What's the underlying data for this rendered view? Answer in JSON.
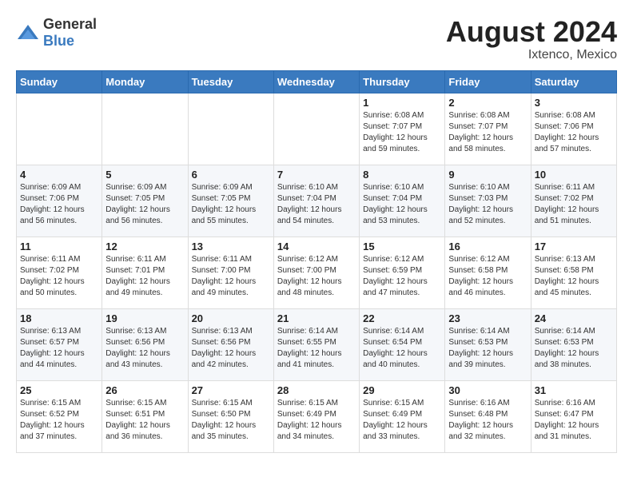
{
  "header": {
    "logo_general": "General",
    "logo_blue": "Blue",
    "month_year": "August 2024",
    "location": "Ixtenco, Mexico"
  },
  "weekdays": [
    "Sunday",
    "Monday",
    "Tuesday",
    "Wednesday",
    "Thursday",
    "Friday",
    "Saturday"
  ],
  "weeks": [
    [
      {
        "day": "",
        "content": ""
      },
      {
        "day": "",
        "content": ""
      },
      {
        "day": "",
        "content": ""
      },
      {
        "day": "",
        "content": ""
      },
      {
        "day": "1",
        "content": "Sunrise: 6:08 AM\nSunset: 7:07 PM\nDaylight: 12 hours\nand 59 minutes."
      },
      {
        "day": "2",
        "content": "Sunrise: 6:08 AM\nSunset: 7:07 PM\nDaylight: 12 hours\nand 58 minutes."
      },
      {
        "day": "3",
        "content": "Sunrise: 6:08 AM\nSunset: 7:06 PM\nDaylight: 12 hours\nand 57 minutes."
      }
    ],
    [
      {
        "day": "4",
        "content": "Sunrise: 6:09 AM\nSunset: 7:06 PM\nDaylight: 12 hours\nand 56 minutes."
      },
      {
        "day": "5",
        "content": "Sunrise: 6:09 AM\nSunset: 7:05 PM\nDaylight: 12 hours\nand 56 minutes."
      },
      {
        "day": "6",
        "content": "Sunrise: 6:09 AM\nSunset: 7:05 PM\nDaylight: 12 hours\nand 55 minutes."
      },
      {
        "day": "7",
        "content": "Sunrise: 6:10 AM\nSunset: 7:04 PM\nDaylight: 12 hours\nand 54 minutes."
      },
      {
        "day": "8",
        "content": "Sunrise: 6:10 AM\nSunset: 7:04 PM\nDaylight: 12 hours\nand 53 minutes."
      },
      {
        "day": "9",
        "content": "Sunrise: 6:10 AM\nSunset: 7:03 PM\nDaylight: 12 hours\nand 52 minutes."
      },
      {
        "day": "10",
        "content": "Sunrise: 6:11 AM\nSunset: 7:02 PM\nDaylight: 12 hours\nand 51 minutes."
      }
    ],
    [
      {
        "day": "11",
        "content": "Sunrise: 6:11 AM\nSunset: 7:02 PM\nDaylight: 12 hours\nand 50 minutes."
      },
      {
        "day": "12",
        "content": "Sunrise: 6:11 AM\nSunset: 7:01 PM\nDaylight: 12 hours\nand 49 minutes."
      },
      {
        "day": "13",
        "content": "Sunrise: 6:11 AM\nSunset: 7:00 PM\nDaylight: 12 hours\nand 49 minutes."
      },
      {
        "day": "14",
        "content": "Sunrise: 6:12 AM\nSunset: 7:00 PM\nDaylight: 12 hours\nand 48 minutes."
      },
      {
        "day": "15",
        "content": "Sunrise: 6:12 AM\nSunset: 6:59 PM\nDaylight: 12 hours\nand 47 minutes."
      },
      {
        "day": "16",
        "content": "Sunrise: 6:12 AM\nSunset: 6:58 PM\nDaylight: 12 hours\nand 46 minutes."
      },
      {
        "day": "17",
        "content": "Sunrise: 6:13 AM\nSunset: 6:58 PM\nDaylight: 12 hours\nand 45 minutes."
      }
    ],
    [
      {
        "day": "18",
        "content": "Sunrise: 6:13 AM\nSunset: 6:57 PM\nDaylight: 12 hours\nand 44 minutes."
      },
      {
        "day": "19",
        "content": "Sunrise: 6:13 AM\nSunset: 6:56 PM\nDaylight: 12 hours\nand 43 minutes."
      },
      {
        "day": "20",
        "content": "Sunrise: 6:13 AM\nSunset: 6:56 PM\nDaylight: 12 hours\nand 42 minutes."
      },
      {
        "day": "21",
        "content": "Sunrise: 6:14 AM\nSunset: 6:55 PM\nDaylight: 12 hours\nand 41 minutes."
      },
      {
        "day": "22",
        "content": "Sunrise: 6:14 AM\nSunset: 6:54 PM\nDaylight: 12 hours\nand 40 minutes."
      },
      {
        "day": "23",
        "content": "Sunrise: 6:14 AM\nSunset: 6:53 PM\nDaylight: 12 hours\nand 39 minutes."
      },
      {
        "day": "24",
        "content": "Sunrise: 6:14 AM\nSunset: 6:53 PM\nDaylight: 12 hours\nand 38 minutes."
      }
    ],
    [
      {
        "day": "25",
        "content": "Sunrise: 6:15 AM\nSunset: 6:52 PM\nDaylight: 12 hours\nand 37 minutes."
      },
      {
        "day": "26",
        "content": "Sunrise: 6:15 AM\nSunset: 6:51 PM\nDaylight: 12 hours\nand 36 minutes."
      },
      {
        "day": "27",
        "content": "Sunrise: 6:15 AM\nSunset: 6:50 PM\nDaylight: 12 hours\nand 35 minutes."
      },
      {
        "day": "28",
        "content": "Sunrise: 6:15 AM\nSunset: 6:49 PM\nDaylight: 12 hours\nand 34 minutes."
      },
      {
        "day": "29",
        "content": "Sunrise: 6:15 AM\nSunset: 6:49 PM\nDaylight: 12 hours\nand 33 minutes."
      },
      {
        "day": "30",
        "content": "Sunrise: 6:16 AM\nSunset: 6:48 PM\nDaylight: 12 hours\nand 32 minutes."
      },
      {
        "day": "31",
        "content": "Sunrise: 6:16 AM\nSunset: 6:47 PM\nDaylight: 12 hours\nand 31 minutes."
      }
    ]
  ]
}
